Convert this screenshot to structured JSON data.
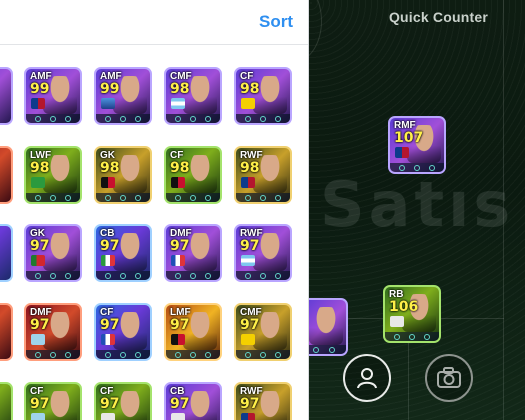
{
  "panel": {
    "sort_label": "Sort"
  },
  "pitch": {
    "title": "Quick Counter",
    "watermark": "Satıs",
    "profile_button_icon": "person-icon",
    "camera_button_icon": "camera-icon"
  },
  "cards": [
    {
      "pos": "AMF",
      "ovr": "99"
    },
    {
      "pos": "AMF",
      "ovr": "99"
    },
    {
      "pos": "CMF",
      "ovr": "98"
    },
    {
      "pos": "CF",
      "ovr": "98"
    },
    {
      "pos": "LWF",
      "ovr": "98"
    },
    {
      "pos": "GK",
      "ovr": "98"
    },
    {
      "pos": "CF",
      "ovr": "98"
    },
    {
      "pos": "RWF",
      "ovr": "98"
    },
    {
      "pos": "GK",
      "ovr": "97"
    },
    {
      "pos": "CB",
      "ovr": "97"
    },
    {
      "pos": "DMF",
      "ovr": "97"
    },
    {
      "pos": "RWF",
      "ovr": "97"
    },
    {
      "pos": "DMF",
      "ovr": "97"
    },
    {
      "pos": "CF",
      "ovr": "97"
    },
    {
      "pos": "LMF",
      "ovr": "97"
    },
    {
      "pos": "CMF",
      "ovr": "97"
    },
    {
      "pos": "CF",
      "ovr": "97"
    },
    {
      "pos": "CF",
      "ovr": "97"
    },
    {
      "pos": "CB",
      "ovr": "97"
    },
    {
      "pos": "RWF",
      "ovr": "97"
    }
  ],
  "field_cards": [
    {
      "pos": "RMF",
      "ovr": "107"
    },
    {
      "pos": "RB",
      "ovr": "106"
    }
  ]
}
